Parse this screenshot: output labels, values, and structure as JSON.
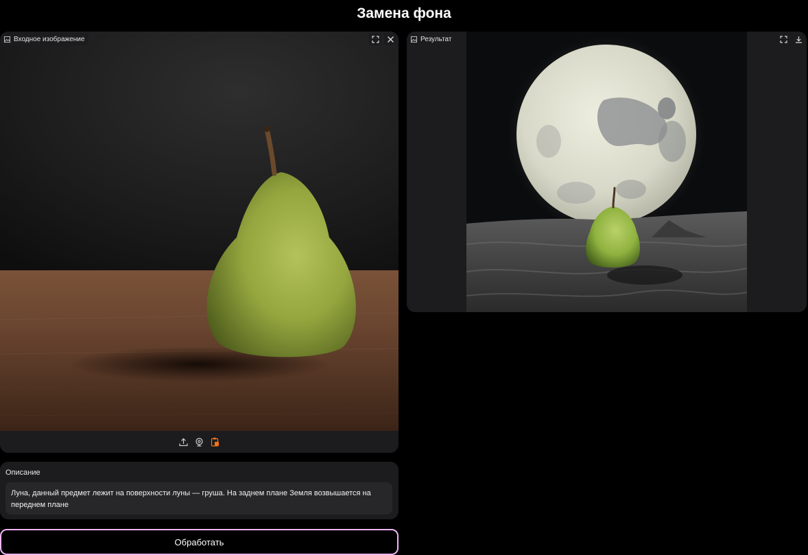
{
  "header": {
    "title": "Замена фона"
  },
  "input_panel": {
    "label": "Входное изображение",
    "label_icon": "image-icon",
    "corner_icons": [
      "fullscreen-icon",
      "close-icon"
    ],
    "toolbar_icons": [
      "upload-icon",
      "webcam-icon",
      "clipboard-paste-icon"
    ],
    "toolbar_accent": "#f97316"
  },
  "result_panel": {
    "label": "Результат",
    "label_icon": "image-icon",
    "corner_icons": [
      "fullscreen-icon",
      "download-icon"
    ]
  },
  "description": {
    "label": "Описание",
    "value": "Луна, данный предмет лежит на поверхности луны — груша. На заднем плане Земля возвышается на переднем плане"
  },
  "process_button": {
    "label": "Обработать",
    "border_color": "#f0b6f7"
  }
}
